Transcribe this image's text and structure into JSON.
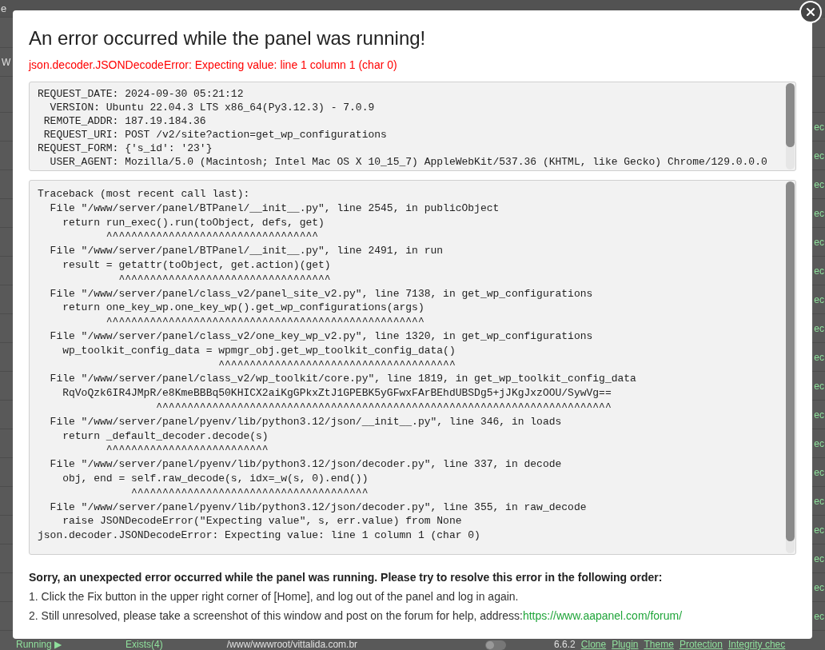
{
  "background_page": {
    "header_fragment": "e",
    "side_fragment": "W",
    "row_fragments": [
      "ec",
      "ec",
      "ec",
      "ec",
      "ec",
      "ec",
      "ec",
      "ec",
      "ec",
      "ec",
      "ec",
      "ec",
      "ec",
      "ec",
      "ec",
      "ec",
      "ec",
      "ec"
    ],
    "bottom_row": {
      "status": "Running ▶",
      "backups": "Exists(4)",
      "path": "/www/wwwroot/vittalida.com.br",
      "toggle_on": false,
      "version": "6.6.2",
      "actions": [
        "Clone",
        "Plugin",
        "Theme",
        "Protection",
        "Integrity chec"
      ]
    }
  },
  "dialog": {
    "title": "An error occurred while the panel was running!",
    "error": "json.decoder.JSONDecodeError: Expecting value: line 1 column 1 (char 0)",
    "request_info": [
      "REQUEST_DATE: 2024-09-30 05:21:12",
      "  VERSION: Ubuntu 22.04.3 LTS x86_64(Py3.12.3) - 7.0.9",
      " REMOTE_ADDR: 187.19.184.36",
      " REQUEST_URI: POST /v2/site?action=get_wp_configurations",
      "REQUEST_FORM: {'s_id': '23'}",
      "  USER_AGENT: Mozilla/5.0 (Macintosh; Intel Mac OS X 10_15_7) AppleWebKit/537.36 (KHTML, like Gecko) Chrome/129.0.0.0"
    ],
    "traceback": [
      "Traceback (most recent call last):",
      "  File \"/www/server/panel/BTPanel/__init__.py\", line 2545, in publicObject",
      "    return run_exec().run(toObject, defs, get)",
      "           ^^^^^^^^^^^^^^^^^^^^^^^^^^^^^^^^^^",
      "  File \"/www/server/panel/BTPanel/__init__.py\", line 2491, in run",
      "    result = getattr(toObject, get.action)(get)",
      "             ^^^^^^^^^^^^^^^^^^^^^^^^^^^^^^^^^^",
      "  File \"/www/server/panel/class_v2/panel_site_v2.py\", line 7138, in get_wp_configurations",
      "    return one_key_wp.one_key_wp().get_wp_configurations(args)",
      "           ^^^^^^^^^^^^^^^^^^^^^^^^^^^^^^^^^^^^^^^^^^^^^^^^^^^",
      "  File \"/www/server/panel/class_v2/one_key_wp_v2.py\", line 1320, in get_wp_configurations",
      "    wp_toolkit_config_data = wpmgr_obj.get_wp_toolkit_config_data()",
      "                             ^^^^^^^^^^^^^^^^^^^^^^^^^^^^^^^^^^^^^^",
      "  File \"/www/server/panel/class_v2/wp_toolkit/core.py\", line 1819, in get_wp_toolkit_config_data",
      "    RqVoQzk6IR4JMpR/e8KmeBBBq50KHICX2aiKgGPkxZtJ1GPEBK5yGFwxFArBEhdUBSDg5+jJKgJxzOOU/SywVg==",
      "                   ^^^^^^^^^^^^^^^^^^^^^^^^^^^^^^^^^^^^^^^^^^^^^^^^^^^^^^^^^^^^^^^^^^^^^^^^^",
      "  File \"/www/server/panel/pyenv/lib/python3.12/json/__init__.py\", line 346, in loads",
      "    return _default_decoder.decode(s)",
      "           ^^^^^^^^^^^^^^^^^^^^^^^^^^",
      "  File \"/www/server/panel/pyenv/lib/python3.12/json/decoder.py\", line 337, in decode",
      "    obj, end = self.raw_decode(s, idx=_w(s, 0).end())",
      "               ^^^^^^^^^^^^^^^^^^^^^^^^^^^^^^^^^^^^^^",
      "  File \"/www/server/panel/pyenv/lib/python3.12/json/decoder.py\", line 355, in raw_decode",
      "    raise JSONDecodeError(\"Expecting value\", s, err.value) from None",
      "json.decoder.JSONDecodeError: Expecting value: line 1 column 1 (char 0)"
    ],
    "help_heading": "Sorry, an unexpected error occurred while the panel was running. Please try to resolve this error in the following order:",
    "help_steps": [
      {
        "text": "1. Click the Fix button in the upper right corner of [Home], and log out of the panel and log in again."
      },
      {
        "text": "2. Still unresolved, please take a screenshot of this window and post on the forum for help, address:",
        "link": "https://www.aapanel.com/forum/"
      }
    ]
  }
}
